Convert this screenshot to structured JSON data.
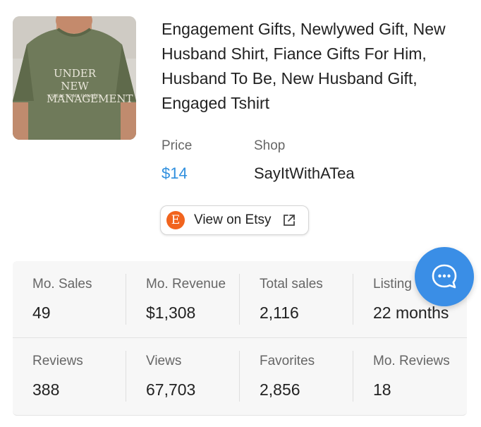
{
  "product": {
    "image_text_main": "UNDER NEW MANAGEMENT",
    "image_text_sub": "(SPEAK TO MY FIANCÉE)",
    "title": "Engagement Gifts, Newlywed Gift, New Husband Shirt, Fiance Gifts For Him, Husband To Be, New Husband Gift, Engaged Tshirt"
  },
  "price": {
    "label": "Price",
    "value": "$14"
  },
  "shop": {
    "label": "Shop",
    "value": "SayItWithATea"
  },
  "etsy_button": {
    "logo": "E",
    "label": "View on Etsy"
  },
  "stats": [
    {
      "label": "Mo. Sales",
      "value": "49"
    },
    {
      "label": "Mo. Revenue",
      "value": "$1,308"
    },
    {
      "label": "Total sales",
      "value": "2,116"
    },
    {
      "label": "Listing",
      "value": "22 months"
    },
    {
      "label": "Reviews",
      "value": "388"
    },
    {
      "label": "Views",
      "value": "67,703"
    },
    {
      "label": "Favorites",
      "value": "2,856"
    },
    {
      "label": "Mo. Reviews",
      "value": "18"
    }
  ],
  "colors": {
    "accent": "#2f8fde",
    "etsy": "#f1641e",
    "chat": "#3a8ee6",
    "shirt": "#6f7a5a"
  }
}
